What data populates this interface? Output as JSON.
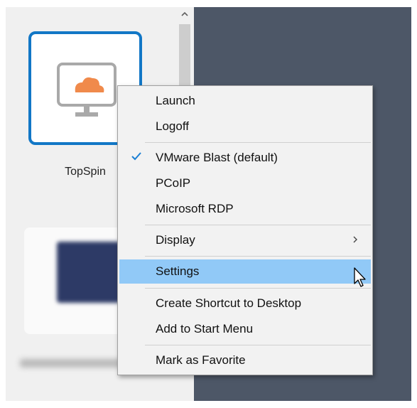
{
  "apps": [
    {
      "label": "TopSpin",
      "icon": "cloud-desktop-icon"
    },
    {
      "label": "",
      "icon": "photoshop-icon"
    }
  ],
  "context_menu": {
    "items": [
      {
        "label": "Launch"
      },
      {
        "label": "Logoff"
      },
      {
        "label": "VMware Blast (default)",
        "checked": true
      },
      {
        "label": "PCoIP"
      },
      {
        "label": "Microsoft RDP"
      },
      {
        "label": "Display",
        "submenu": true
      },
      {
        "label": "Settings",
        "highlighted": true
      },
      {
        "label": "Create Shortcut to Desktop"
      },
      {
        "label": "Add to Start Menu"
      },
      {
        "label": "Mark as Favorite"
      }
    ]
  },
  "colors": {
    "selection_border": "#1277c6",
    "highlight": "#91c9f7",
    "cloud": "#f08a4b",
    "backdrop": "#4d5767",
    "checkmark": "#1a7fd4"
  }
}
